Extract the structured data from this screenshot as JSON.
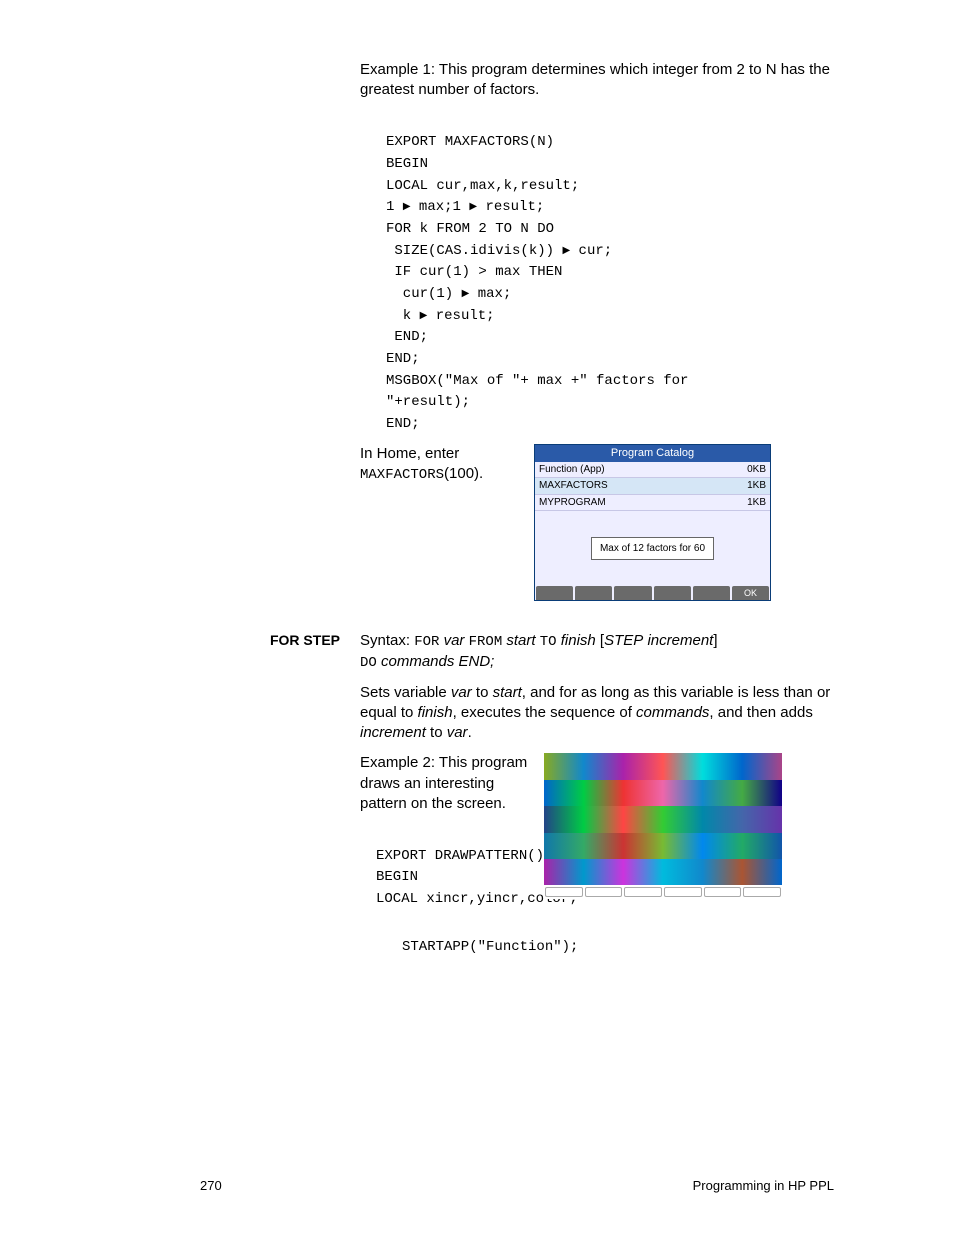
{
  "intro": "Example 1: This program determines which integer from 2 to N has the greatest number of factors.",
  "code1": {
    "l1": "EXPORT MAXFACTORS(N)",
    "l2": "BEGIN",
    "l3": "LOCAL cur,max,k,result;",
    "l4a": "1",
    "l4b": "max;1",
    "l4c": "result;",
    "l5": "FOR k FROM 2 TO N DO",
    "l6a": " SIZE(CAS.idivis(k))",
    "l6b": "cur;",
    "l7": " IF cur(1) > max THEN",
    "l8a": "  cur(1)",
    "l8b": "max;",
    "l9a": "  k",
    "l9b": "result;",
    "l10": " END;",
    "l11": "END;",
    "l12": "MSGBOX(\"Max of \"+ max +\" factors for \n\"+result);",
    "l13": "END;"
  },
  "home_enter": "In Home, enter",
  "maxfactors_call1": "MAXFACTORS",
  "maxfactors_call2": "(100).",
  "calc": {
    "title": "Program Catalog",
    "row1a": "Function (App)",
    "row1b": "0KB",
    "row2a": "MAXFACTORS",
    "row2b": "1KB",
    "row3a": "MYPROGRAM",
    "row3b": "1KB",
    "msg": "Max of 12 factors for 60",
    "ok": "OK"
  },
  "section": "FOR STEP",
  "syntax": {
    "prefix": "Syntax: ",
    "for": "FOR",
    "var": "var",
    "from": "FROM",
    "start": "start",
    "to": "TO",
    "finish": "finish",
    "step": "STEP",
    "increment": "increment",
    "do": "DO",
    "commands": "commands END;"
  },
  "desc1": "Sets variable ",
  "desc_var": "var",
  "desc2": " to ",
  "desc_start": "start",
  "desc3": ", and for as long as this variable is less than or equal to ",
  "desc_finish": "finish",
  "desc4": ", executes the sequence of ",
  "desc_commands": "commands",
  "desc5": ", and then adds ",
  "desc_increment": "increment",
  "desc6": " to ",
  "desc_var2": "var",
  "desc7": ".",
  "ex2": "Example 2: This program draws an interesting pattern on the screen.",
  "code2": {
    "l1": "EXPORT DRAWPATTERN()",
    "l2": "BEGIN",
    "l3": "LOCAL xincr,yincr,color;",
    "l4": "STARTAPP(\"Function\");"
  },
  "page_number": "270",
  "footer_right": "Programming in HP PPL"
}
